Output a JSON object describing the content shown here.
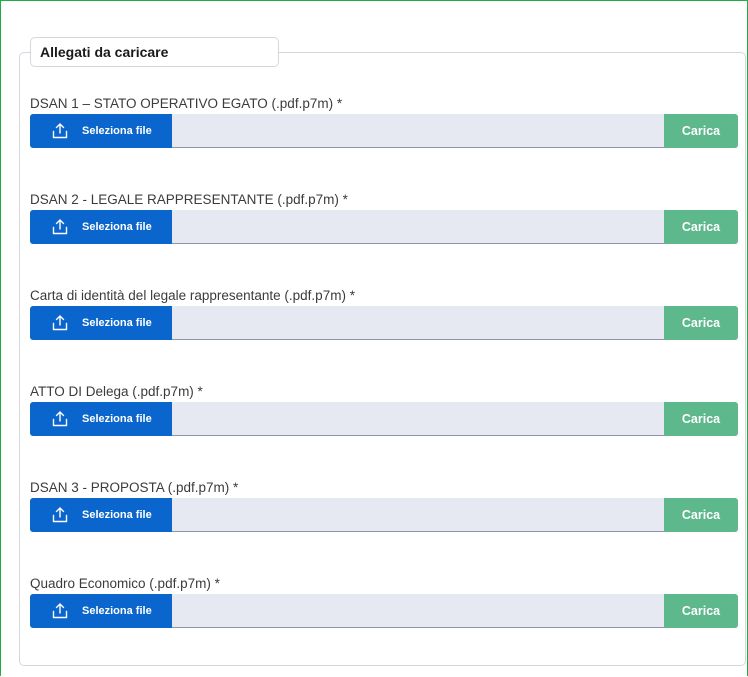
{
  "section": {
    "legend": "Allegati da caricare"
  },
  "buttons": {
    "select_label": "Seleziona file",
    "upload_label": "Carica"
  },
  "fields": [
    {
      "label": "DSAN 1 – STATO OPERATIVO EGATO (.pdf.p7m) *"
    },
    {
      "label": "DSAN 2 - LEGALE RAPPRESENTANTE (.pdf.p7m) *"
    },
    {
      "label": "Carta di identità del legale rappresentante (.pdf.p7m) *"
    },
    {
      "label": "ATTO DI Delega (.pdf.p7m) *"
    },
    {
      "label": "DSAN 3 - PROPOSTA (.pdf.p7m) *"
    },
    {
      "label": "Quadro Economico (.pdf.p7m) *"
    }
  ],
  "colors": {
    "select_button": "#0a66cc",
    "upload_button": "#5db88b",
    "file_track": "#e6e9f1",
    "frame_border": "#22aa44"
  },
  "icons": {
    "select_button_icon": "upload-icon"
  }
}
